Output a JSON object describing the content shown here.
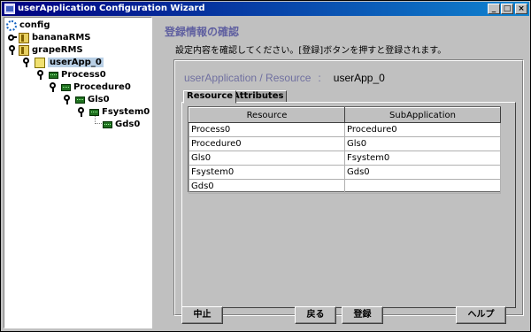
{
  "window": {
    "title": "userApplication Configuration Wizard",
    "minimize": "_",
    "maximize": "□",
    "close": "×"
  },
  "tree": {
    "config": "config",
    "banana": "bananaRMS",
    "grape": "grapeRMS",
    "userapp": "userApp_0",
    "process": "Process0",
    "procedure": "Procedure0",
    "gls": "Gls0",
    "fsystem": "Fsystem0",
    "gds": "Gds0"
  },
  "main": {
    "heading": "登録情報の確認",
    "instruction": "設定内容を確認してください。[登録]ボタンを押すと登録されます。",
    "path_label": "userApplication / Resource",
    "path_sep": ":",
    "path_value": "userApp_0",
    "tabs": {
      "resource": "Resource",
      "attributes": "Attributes"
    },
    "columns": [
      "Resource",
      "SubApplication"
    ],
    "rows": [
      [
        "Process0",
        "Procedure0"
      ],
      [
        "Procedure0",
        "Gls0"
      ],
      [
        "Gls0",
        "Fsystem0"
      ],
      [
        "Fsystem0",
        "Gds0"
      ],
      [
        "Gds0",
        ""
      ]
    ]
  },
  "buttons": {
    "cancel": "中止",
    "back": "戻る",
    "register": "登録",
    "help": "ヘルプ"
  }
}
